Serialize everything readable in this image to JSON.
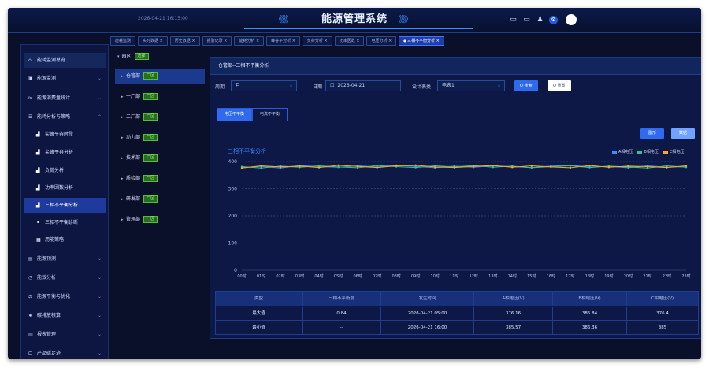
{
  "header": {
    "datetime": "2026-04-21 16:15:00",
    "title": "能源管理系统",
    "chevrons_left": "《《《",
    "chevrons_right": "》》》"
  },
  "top_icons": [
    "monitor-icon",
    "monitor-icon",
    "bell-icon",
    "gear-icon",
    "avatar"
  ],
  "tabs": [
    {
      "label": "能耗监测",
      "active": false
    },
    {
      "label": "实时数据 ×",
      "active": false
    },
    {
      "label": "历史数据 ×",
      "active": false
    },
    {
      "label": "报警记录 ×",
      "active": false
    },
    {
      "label": "能耗分析 ×",
      "active": false
    },
    {
      "label": "峰谷平分析 ×",
      "active": false
    },
    {
      "label": "负荷分析 ×",
      "active": false
    },
    {
      "label": "功率因数 ×",
      "active": false
    },
    {
      "label": "电压分析 ×",
      "active": false
    },
    {
      "label": "三相不平衡分析 ×",
      "active": true
    }
  ],
  "sidebar": {
    "items": [
      {
        "label": "能耗监测总览",
        "icon": "home-icon",
        "type": "hdr",
        "arrow": ""
      },
      {
        "label": "能源监测",
        "icon": "monitor-icon",
        "type": "main",
        "arrow": "⌄"
      },
      {
        "label": "能源消费量统计",
        "icon": "chart-icon",
        "type": "main",
        "arrow": "⌄"
      },
      {
        "label": "能耗分析与策略",
        "icon": "list-icon",
        "type": "main",
        "arrow": "⌃"
      },
      {
        "label": "尖峰平谷时段",
        "icon": "bar-icon",
        "type": "sub",
        "arrow": ""
      },
      {
        "label": "尖峰平谷分析",
        "icon": "bar-icon",
        "type": "sub",
        "arrow": ""
      },
      {
        "label": "负荷分析",
        "icon": "bar-icon",
        "type": "sub",
        "arrow": ""
      },
      {
        "label": "功率因数分析",
        "icon": "bar-icon",
        "type": "sub",
        "arrow": ""
      },
      {
        "label": "三相不平衡分析",
        "icon": "bar-icon",
        "type": "sub active",
        "arrow": ""
      },
      {
        "label": "三相不平衡诊断",
        "icon": "link-icon",
        "type": "sub",
        "arrow": ""
      },
      {
        "label": "用能策略",
        "icon": "grid-icon",
        "type": "sub",
        "arrow": ""
      },
      {
        "label": "能源预测",
        "icon": "doc-icon",
        "type": "main",
        "arrow": "⌄"
      },
      {
        "label": "能效分析",
        "icon": "gauge-icon",
        "type": "main",
        "arrow": "⌄"
      },
      {
        "label": "能源平衡与优化",
        "icon": "balance-icon",
        "type": "main",
        "arrow": "⌄"
      },
      {
        "label": "碳排放核算",
        "icon": "leaf-icon",
        "type": "main",
        "arrow": "⌄"
      },
      {
        "label": "报表管理",
        "icon": "report-icon",
        "type": "main",
        "arrow": "⌄"
      },
      {
        "label": "产品碳足迹",
        "icon": "foot-icon",
        "type": "main",
        "arrow": "⌄"
      }
    ]
  },
  "tree": {
    "root": {
      "label": "园区",
      "tag": "选择"
    },
    "nodes": [
      {
        "label": "仓管部",
        "tag": "厂区",
        "active": true
      },
      {
        "label": "一厂部",
        "tag": "厂区",
        "active": false
      },
      {
        "label": "二厂部",
        "tag": "厂区",
        "active": false
      },
      {
        "label": "动力部",
        "tag": "厂区",
        "active": false
      },
      {
        "label": "技术部",
        "tag": "厂区",
        "active": false
      },
      {
        "label": "质检部",
        "tag": "厂区",
        "active": false
      },
      {
        "label": "研发部",
        "tag": "厂区",
        "active": false
      },
      {
        "label": "管理部",
        "tag": "厂区",
        "active": false
      }
    ]
  },
  "content": {
    "header": "仓管部--三相不平衡分析",
    "filters": {
      "period_label": "周期",
      "period_value": "月",
      "date_label": "日期",
      "date_value": "2026-04-21",
      "meter_label": "设计表类",
      "meter_value": "电表1",
      "search_btn": "Q 搜索",
      "reset_btn": "Q 重置"
    },
    "subtabs": [
      {
        "label": "电压不平衡",
        "active": true
      },
      {
        "label": "电流不平衡",
        "active": false
      }
    ],
    "chart_buttons": [
      "图形",
      "数据"
    ],
    "chart_title": "三相不平衡分析",
    "legend": [
      {
        "label": "A相电压",
        "color": "#3b8cff"
      },
      {
        "label": "B相电压",
        "color": "#31c48d"
      },
      {
        "label": "C相电压",
        "color": "#ffa726"
      }
    ]
  },
  "chart_data": {
    "type": "line",
    "title": "三相不平衡分析",
    "x": [
      "00时",
      "01时",
      "02时",
      "03时",
      "04时",
      "05时",
      "06时",
      "07时",
      "08时",
      "09时",
      "10时",
      "11时",
      "12时",
      "13时",
      "14时",
      "15时",
      "16时",
      "17时",
      "18时",
      "19时",
      "20时",
      "21时",
      "22时",
      "23时"
    ],
    "ylim": [
      0,
      400
    ],
    "yticks": [
      0,
      100,
      200,
      300,
      400
    ],
    "grid": true,
    "legend_position": "top-right",
    "series": [
      {
        "name": "A相电压",
        "color": "#3b8cff",
        "values": [
          378,
          382,
          376,
          385,
          381,
          379,
          384,
          380,
          386,
          382,
          377,
          383,
          379,
          384,
          381,
          378,
          383,
          386,
          380,
          382,
          377,
          384,
          379,
          381
        ]
      },
      {
        "name": "B相电压",
        "color": "#31c48d",
        "values": [
          381,
          376,
          383,
          379,
          384,
          380,
          377,
          385,
          381,
          378,
          384,
          380,
          385,
          379,
          383,
          377,
          381,
          384,
          378,
          383,
          380,
          376,
          384,
          379
        ]
      },
      {
        "name": "C相电压",
        "color": "#ffa726",
        "values": [
          376,
          384,
          380,
          383,
          378,
          386,
          382,
          378,
          384,
          386,
          380,
          378,
          382,
          385,
          379,
          384,
          380,
          377,
          385,
          379,
          383,
          381,
          378,
          384
        ]
      }
    ]
  },
  "table": {
    "columns": [
      "类型",
      "三相不平衡度",
      "发生时间",
      "A相电压(V)",
      "B相电压(V)",
      "C相电压(V)"
    ],
    "rows": [
      [
        "最大值",
        "0.84",
        "2026-04-21 05:00",
        "376.16",
        "385.84",
        "376.4"
      ],
      [
        "最小值",
        "--",
        "2026-04-21 16:00",
        "385.57",
        "386.36",
        "385"
      ]
    ]
  }
}
